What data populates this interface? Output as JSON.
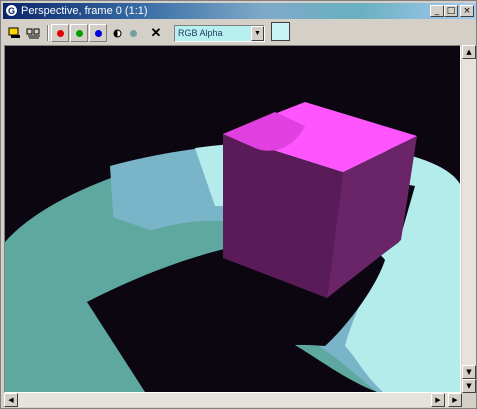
{
  "window": {
    "title": "Perspective, frame 0 (1:1)",
    "app_icon_glyph": "G",
    "controls": {
      "minimize": "_",
      "maximize": "□",
      "close": "×"
    }
  },
  "toolbar": {
    "buttons": [
      {
        "name": "save-image-icon",
        "glyph": "▭"
      },
      {
        "name": "clone-icon",
        "glyph": "ꔶ"
      },
      {
        "name": "red-channel-button",
        "color": "#e00000"
      },
      {
        "name": "green-channel-button",
        "color": "#00a000"
      },
      {
        "name": "blue-channel-button",
        "color": "#0000e0"
      },
      {
        "name": "mono-channel-button",
        "glyph": "◐"
      },
      {
        "name": "alpha-channel-button",
        "color": "#70a0a0"
      },
      {
        "name": "clear-button",
        "glyph": "✕"
      }
    ],
    "channel_select": {
      "value": "RGB Alpha"
    },
    "swatch_color": "#c8f4f4"
  },
  "scrollbars": {
    "up": "▲",
    "down": "▼",
    "left": "◀",
    "right": "▶"
  },
  "colors": {
    "background": "#0b0610",
    "torus_dark": "#5ea8a0",
    "torus_mid": "#7ab4c8",
    "torus_light": "#b4ecec",
    "cube_top": "#ff55ff",
    "cube_front": "#5a1c58",
    "cube_side": "#6a2468"
  }
}
